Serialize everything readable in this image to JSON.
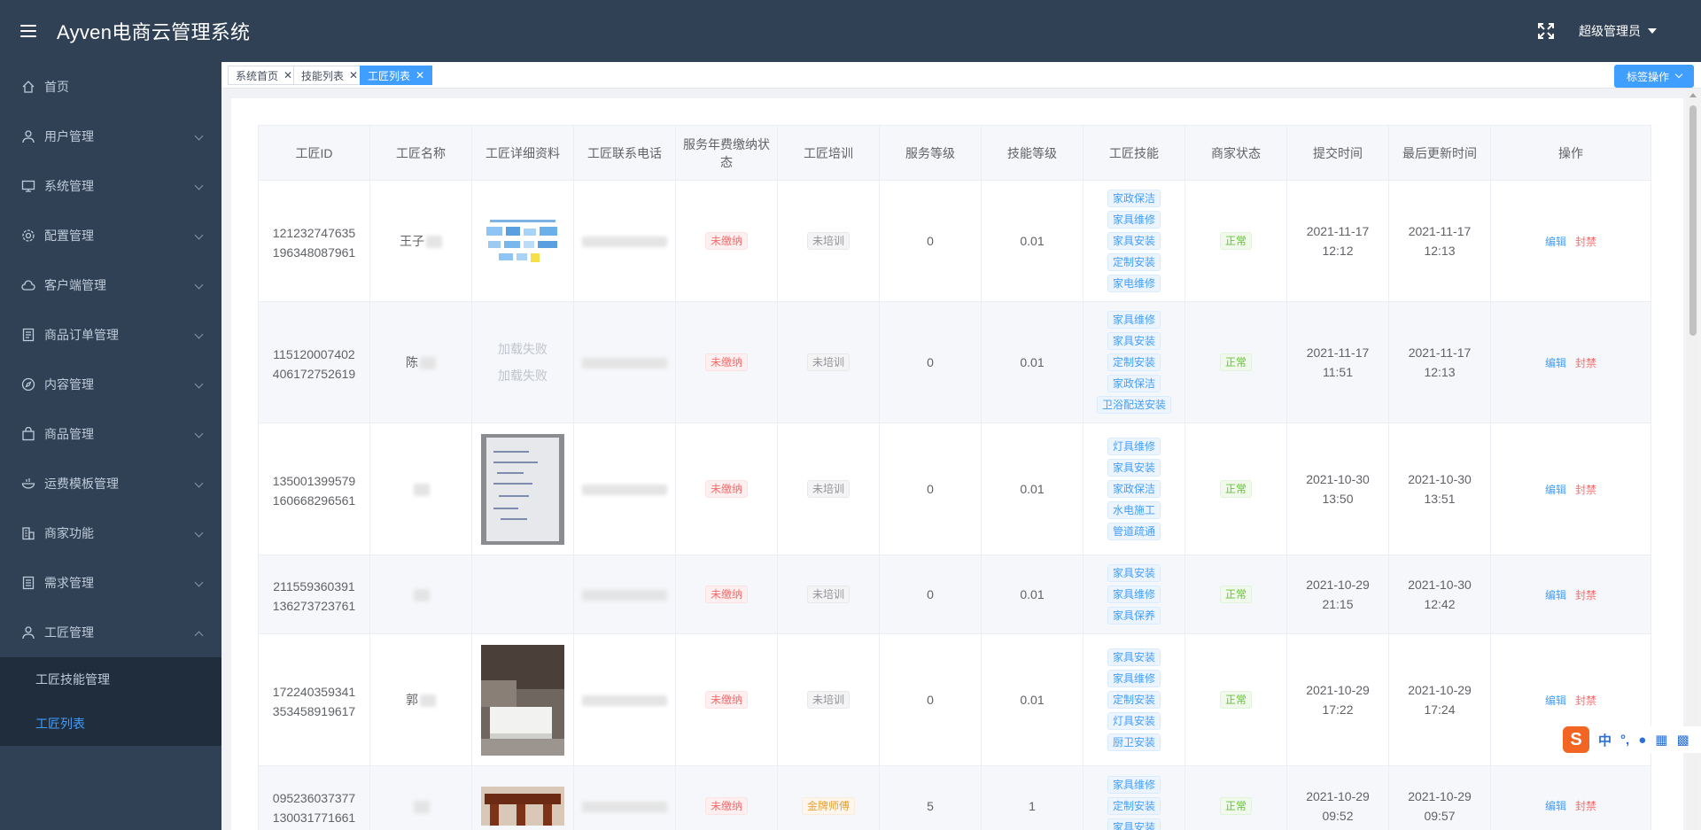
{
  "header": {
    "app_title": "Ayven电商云管理系统",
    "user_label": "超级管理员"
  },
  "sidebar": {
    "items": [
      {
        "label": "首页",
        "icon": "home-icon",
        "has_arrow": false
      },
      {
        "label": "用户管理",
        "icon": "user-icon",
        "has_arrow": true
      },
      {
        "label": "系统管理",
        "icon": "monitor-icon",
        "has_arrow": true
      },
      {
        "label": "配置管理",
        "icon": "gear-icon",
        "has_arrow": true
      },
      {
        "label": "客户端管理",
        "icon": "cloud-icon",
        "has_arrow": true
      },
      {
        "label": "商品订单管理",
        "icon": "document-icon",
        "has_arrow": true
      },
      {
        "label": "内容管理",
        "icon": "compass-icon",
        "has_arrow": true
      },
      {
        "label": "商品管理",
        "icon": "bag-icon",
        "has_arrow": true
      },
      {
        "label": "运费模板管理",
        "icon": "bowl-icon",
        "has_arrow": true
      },
      {
        "label": "商家功能",
        "icon": "building-icon",
        "has_arrow": true
      },
      {
        "label": "需求管理",
        "icon": "list-icon",
        "has_arrow": true
      },
      {
        "label": "工匠管理",
        "icon": "user-icon",
        "has_arrow": true
      }
    ],
    "sub_items": [
      {
        "label": "工匠技能管理",
        "active": false
      },
      {
        "label": "工匠列表",
        "active": true
      }
    ]
  },
  "tags": {
    "items": [
      {
        "label": "系统首页",
        "active": false
      },
      {
        "label": "技能列表",
        "active": false
      },
      {
        "label": "工匠列表",
        "active": true
      }
    ],
    "ops_label": "标签操作"
  },
  "table": {
    "headers": [
      "工匠ID",
      "工匠名称",
      "工匠详细资料",
      "工匠联系电话",
      "服务年费缴纳状态",
      "工匠培训",
      "服务等级",
      "技能等级",
      "工匠技能",
      "商家状态",
      "提交时间",
      "最后更新时间",
      "操作"
    ],
    "edit_label": "编辑",
    "ban_label": "封禁",
    "load_fail": "加载失败",
    "rows": [
      {
        "id1": "121232747635",
        "id2": "196348087961",
        "name": "王子",
        "photo": "diagram",
        "fee": "未缴纳",
        "training": "未培训",
        "training_type": "gray",
        "service_level": "0",
        "skill_level": "0.01",
        "skills": [
          "家政保洁",
          "家具维修",
          "家具安装",
          "定制安装",
          "家电维修"
        ],
        "status": "正常",
        "submit_date": "2021-11-17",
        "submit_time": "12:12",
        "update_date": "2021-11-17",
        "update_time": "12:13"
      },
      {
        "id1": "115120007402",
        "id2": "406172752619",
        "name": "陈",
        "photo": "fail",
        "fee": "未缴纳",
        "training": "未培训",
        "training_type": "gray",
        "service_level": "0",
        "skill_level": "0.01",
        "skills": [
          "家具维修",
          "家具安装",
          "定制安装",
          "家政保洁",
          "卫浴配送安装"
        ],
        "status": "正常",
        "submit_date": "2021-11-17",
        "submit_time": "11:51",
        "update_date": "2021-11-17",
        "update_time": "12:13"
      },
      {
        "id1": "135001399579",
        "id2": "160668296561",
        "name": "",
        "photo": "paper",
        "fee": "未缴纳",
        "training": "未培训",
        "training_type": "gray",
        "service_level": "0",
        "skill_level": "0.01",
        "skills": [
          "灯具维修",
          "家具安装",
          "家政保洁",
          "水电施工",
          "管道疏通"
        ],
        "status": "正常",
        "submit_date": "2021-10-30",
        "submit_time": "13:50",
        "update_date": "2021-10-30",
        "update_time": "13:51"
      },
      {
        "id1": "211559360391",
        "id2": "136273723761",
        "name": "",
        "photo": "none",
        "fee": "未缴纳",
        "training": "未培训",
        "training_type": "gray",
        "service_level": "0",
        "skill_level": "0.01",
        "skills": [
          "家具安装",
          "家具维修",
          "家具保养"
        ],
        "status": "正常",
        "submit_date": "2021-10-29",
        "submit_time": "21:15",
        "update_date": "2021-10-30",
        "update_time": "12:42"
      },
      {
        "id1": "172240359341",
        "id2": "353458919617",
        "name": "郭",
        "photo": "room",
        "fee": "未缴纳",
        "training": "未培训",
        "training_type": "gray",
        "service_level": "0",
        "skill_level": "0.01",
        "skills": [
          "家具安装",
          "家具维修",
          "定制安装",
          "灯具安装",
          "厨卫安装"
        ],
        "status": "正常",
        "submit_date": "2021-10-29",
        "submit_time": "17:22",
        "update_date": "2021-10-29",
        "update_time": "17:24"
      },
      {
        "id1": "095236037377",
        "id2": "130031771661",
        "name": "",
        "photo": "furniture",
        "fee": "未缴纳",
        "training": "金牌师傅",
        "training_type": "orange",
        "service_level": "5",
        "skill_level": "1",
        "skills": [
          "家具维修",
          "定制安装",
          "家具安装"
        ],
        "status": "正常",
        "submit_date": "2021-10-29",
        "submit_time": "09:52",
        "update_date": "2021-10-29",
        "update_time": "09:57"
      }
    ]
  },
  "ime": {
    "logo": "S",
    "lang": "中"
  }
}
